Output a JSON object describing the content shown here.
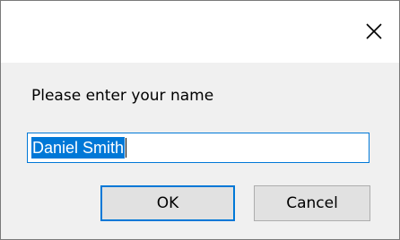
{
  "dialog": {
    "close_icon": "close-icon",
    "prompt": "Please enter your name",
    "input_value": "Daniel Smith",
    "ok_label": "OK",
    "cancel_label": "Cancel",
    "colors": {
      "accent": "#0078d7",
      "dialog_bg": "#f0f0f0",
      "button_bg": "#e1e1e1"
    }
  }
}
